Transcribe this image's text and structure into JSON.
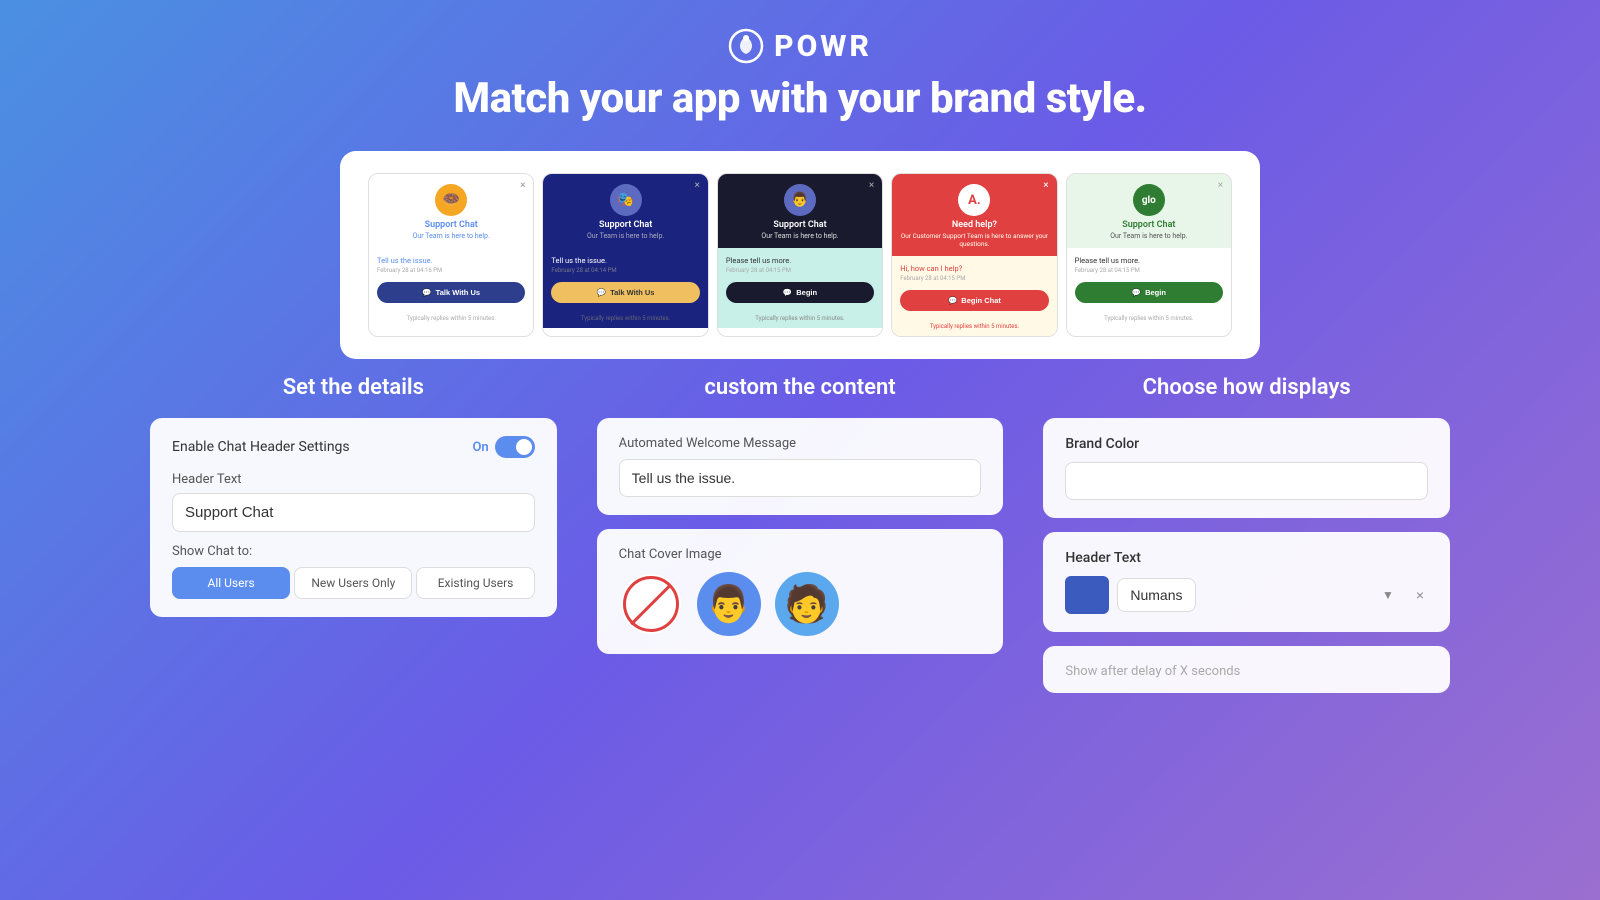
{
  "header": {
    "logo_text": "POWR",
    "headline": "Match your app with your brand style."
  },
  "preview": {
    "cards": [
      {
        "id": "card1",
        "title": "Support Chat",
        "subtitle": "Our Team is here to help.",
        "avatar_emoji": "🍩",
        "message": "Tell us the issue.",
        "time": "February 28 at 04:16 PM",
        "btn_label": "Talk With Us",
        "footer": "Typically replies within 5 minutes.",
        "theme": "white"
      },
      {
        "id": "card2",
        "title": "Support Chat",
        "subtitle": "Our Team is here to help.",
        "avatar_emoji": "🎭",
        "message": "Tell us the issue.",
        "time": "February 28 at 04:14 PM",
        "btn_label": "Talk With Us",
        "footer": "Typically replies within 5 minutes.",
        "theme": "dark-blue"
      },
      {
        "id": "card3",
        "title": "Support Chat",
        "subtitle": "Our Team is here to help.",
        "avatar_emoji": "👨",
        "message": "Please tell us more.",
        "time": "February 28 at 04:15 PM",
        "btn_label": "Begin",
        "footer": "Typically replies within 5 minutes.",
        "theme": "teal"
      },
      {
        "id": "card4",
        "title": "Need help?",
        "subtitle": "Our Customer Support Team is here to answer your questions.",
        "avatar_emoji": "🅰️",
        "message": "Hi, how can I help?",
        "time": "February 28 at 04:15 PM",
        "btn_label": "Begin Chat",
        "footer": "Typically replies within 5 minutes.",
        "theme": "red"
      },
      {
        "id": "card5",
        "title": "Support Chat",
        "subtitle": "Our Team is here to help.",
        "avatar_emoji": "glo",
        "message": "Please tell us more.",
        "time": "February 28 at 04:15 PM",
        "btn_label": "Begin",
        "footer": "Typically replies within 5 minutes.",
        "theme": "green"
      }
    ]
  },
  "sections": {
    "left": {
      "title": "Set the details",
      "enable_label": "Enable Chat Header Settings",
      "toggle_on_text": "On",
      "header_text_label": "Header Text",
      "header_text_value": "Support Chat",
      "show_chat_to_label": "Show Chat to:",
      "audience_options": [
        "All Users",
        "New Users Only",
        "Existing Users"
      ]
    },
    "middle": {
      "title": "custom the content",
      "welcome_label": "Automated Welcome Message",
      "welcome_value": "Tell us the issue.",
      "cover_label": "Chat Cover Image"
    },
    "right": {
      "title": "Choose how displays",
      "brand_color_label": "Brand Color",
      "header_text_label": "Header Text",
      "font_name": "Numans",
      "delay_placeholder": "Show after delay of X seconds"
    }
  }
}
